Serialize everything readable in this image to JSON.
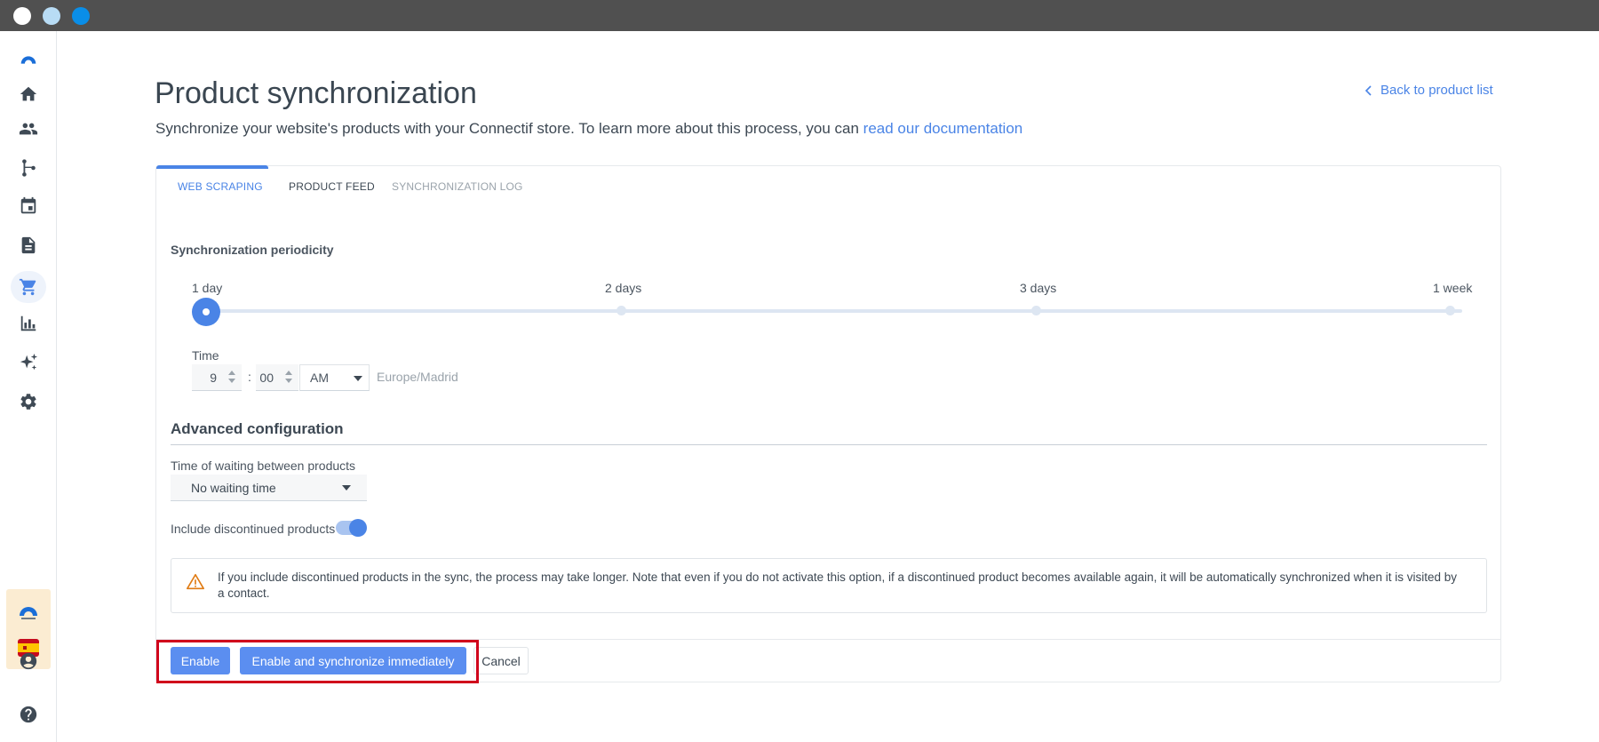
{
  "page": {
    "title": "Product synchronization",
    "subtitle_prefix": "Synchronize your website's products with your Connectif store. To learn more about this process, you can",
    "subtitle_link": "read our documentation",
    "back_link": "Back to product list"
  },
  "tabs": [
    {
      "label": "WEB SCRAPING",
      "active": true
    },
    {
      "label": "PRODUCT FEED",
      "active": false
    },
    {
      "label": "SYNCHRONIZATION LOG",
      "active": false
    }
  ],
  "periodicity": {
    "label": "Synchronization periodicity",
    "options": [
      "1 day",
      "2 days",
      "3 days",
      "1 week"
    ],
    "selected": "1 day"
  },
  "time": {
    "label": "Time",
    "hour": "9",
    "separator": ":",
    "minute": "00",
    "period": "AM",
    "timezone": "Europe/Madrid"
  },
  "advanced": {
    "title": "Advanced configuration",
    "waiting_label": "Time of waiting between products",
    "waiting_value": "No waiting time",
    "discontinued_label": "Include discontinued products",
    "discontinued_enabled": true,
    "notice": "If you include discontinued products in the sync, the process may take longer. Note that even if you do not activate this option, if a discontinued product becomes available again, it will be automatically synchronized when it is visited by a contact."
  },
  "actions": {
    "enable": "Enable",
    "enable_sync": "Enable and synchronize immediately",
    "cancel": "Cancel"
  },
  "sidebar": {
    "items": [
      "home-icon",
      "contacts-icon",
      "workflows-icon",
      "calendar-icon",
      "content-icon",
      "store-icon",
      "reports-icon",
      "ai-icon",
      "settings-icon"
    ],
    "active": "store-icon",
    "bottom": [
      "account-icon",
      "help-icon"
    ]
  },
  "colors": {
    "accent": "#4a84e6",
    "highlight": "#d0021b",
    "titlebar": "#505050"
  }
}
